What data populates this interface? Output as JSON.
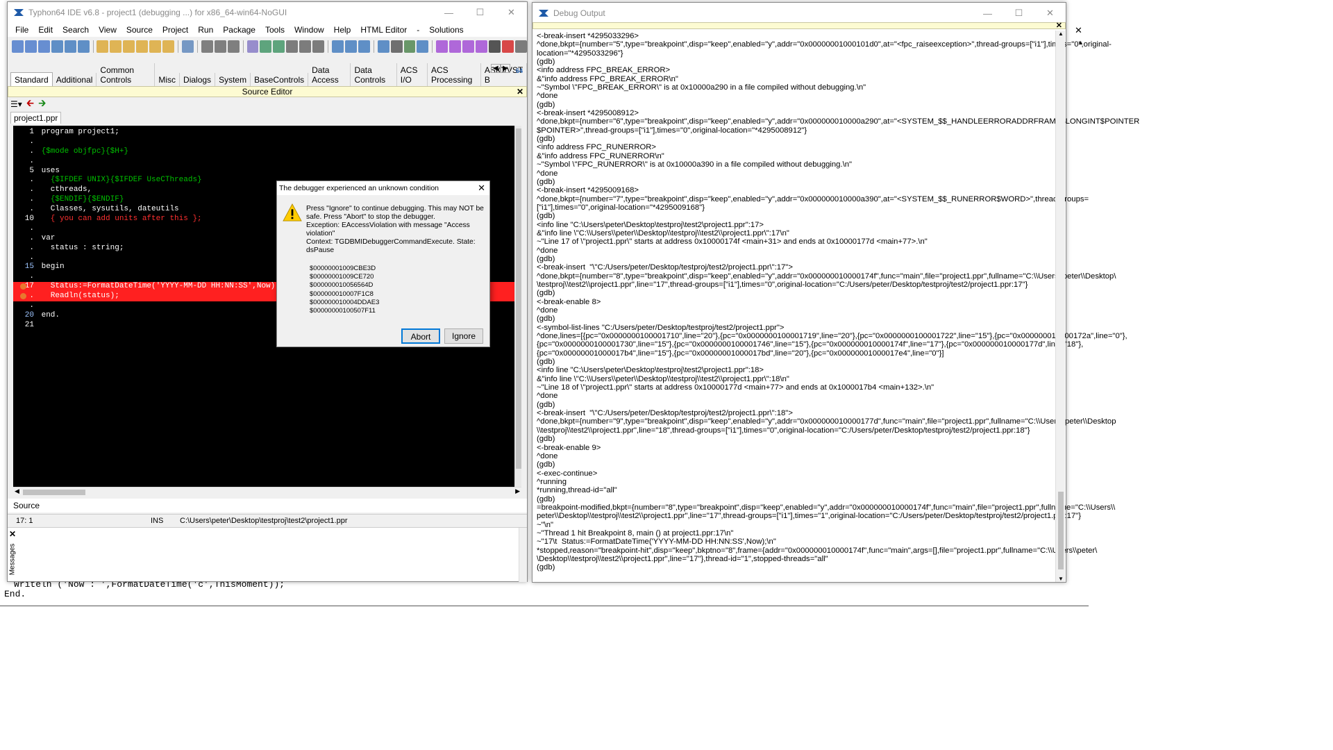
{
  "ide": {
    "title": "Typhon64 IDE v6.8 - project1 (debugging ...) for x86_64-win64-NoGUI",
    "menu": [
      "File",
      "Edit",
      "Search",
      "View",
      "Source",
      "Project",
      "Run",
      "Package",
      "Tools",
      "Window",
      "Help",
      "HTML Editor",
      "-",
      "Solutions"
    ],
    "palette_tabs": [
      "Standard",
      "Additional",
      "Common Controls",
      "Misc",
      "Dialogs",
      "System",
      "BaseControls",
      "Data Access",
      "Data Controls",
      "ACS I/O",
      "ACS Processing",
      "ASIO/VST B"
    ],
    "badge_64": "64",
    "source_editor_title": "Source Editor",
    "file_tab": "project1.ppr",
    "bottom_tab": "Source",
    "status": {
      "pos": "17:  1",
      "mode": "INS",
      "path": "C:\\Users\\peter\\Desktop\\testproj\\test2\\project1.ppr"
    },
    "messages_label": "Messages"
  },
  "code": [
    {
      "n": "1",
      "t": "program project1;"
    },
    {
      "n": ".",
      "t": ""
    },
    {
      "n": ".",
      "t": "{$mode objfpc}{$H+}"
    },
    {
      "n": ".",
      "t": ""
    },
    {
      "n": "5",
      "t": "uses"
    },
    {
      "n": ".",
      "t": "  {$IFDEF UNIX}{$IFDEF UseCThreads}"
    },
    {
      "n": ".",
      "t": "  cthreads,"
    },
    {
      "n": ".",
      "t": "  {$ENDIF}{$ENDIF}"
    },
    {
      "n": ".",
      "t": "  Classes, sysutils, dateutils"
    },
    {
      "n": "10",
      "t": "  { you can add units after this };"
    },
    {
      "n": ".",
      "t": ""
    },
    {
      "n": ".",
      "t": "var"
    },
    {
      "n": ".",
      "t": "  status : string;"
    },
    {
      "n": ".",
      "t": ""
    },
    {
      "n": "15",
      "t": "begin"
    },
    {
      "n": ".",
      "t": ""
    },
    {
      "n": "17",
      "t": "  Status:=FormatDateTime('YYYY-MM-DD HH:NN:SS',Now);"
    },
    {
      "n": ".",
      "t": "  Readln(status);"
    },
    {
      "n": ".",
      "t": ""
    },
    {
      "n": "20",
      "t": "end."
    },
    {
      "n": "21",
      "t": ""
    }
  ],
  "background_code": [
    "Writeln ('Now : ',FormatDateTime('c',ThisMoment));",
    "End."
  ],
  "dialog": {
    "title": "The debugger experienced an unknown condition",
    "message": "Press \"Ignore\" to continue debugging. This may NOT be\nsafe. Press \"Abort\" to stop the debugger.\nException: EAccessViolation with message \"Access\nviolation\"\nContext: TGDBMIDebuggerCommandExecute. State:\ndsPause",
    "addresses": [
      "$00000001009CBE3D",
      "$00000001009CE720",
      "$000000010056564D",
      "$000000010007F1C8",
      "$000000010004DDAE3",
      "$00000000100507F11"
    ],
    "abort_label": "Abort",
    "ignore_label": "Ignore"
  },
  "debug": {
    "title": "Debug Output",
    "lines": [
      "<-break-insert *4295033296>",
      "^done,bkpt={number=\"5\",type=\"breakpoint\",disp=\"keep\",enabled=\"y\",addr=\"0x00000001000101d0\",at=\"<fpc_raiseexception>\",thread-groups=[\"i1\"],times=\"0\",original-",
      "location=\"*4295033296\"}",
      "(gdb)",
      "<info address FPC_BREAK_ERROR>",
      "&\"info address FPC_BREAK_ERROR\\n\"",
      "~\"Symbol \\\"FPC_BREAK_ERROR\\\" is at 0x10000a290 in a file compiled without debugging.\\n\"",
      "^done",
      "(gdb)",
      "<-break-insert *4295008912>",
      "^done,bkpt={number=\"6\",type=\"breakpoint\",disp=\"keep\",enabled=\"y\",addr=\"0x000000010000a290\",at=\"<SYSTEM_$$_HANDLEERRORADDRFRAME$LONGINT$POINTER",
      "$POINTER>\",thread-groups=[\"i1\"],times=\"0\",original-location=\"*4295008912\"}",
      "(gdb)",
      "<info address FPC_RUNERROR>",
      "&\"info address FPC_RUNERROR\\n\"",
      "~\"Symbol \\\"FPC_RUNERROR\\\" is at 0x10000a390 in a file compiled without debugging.\\n\"",
      "^done",
      "(gdb)",
      "<-break-insert *4295009168>",
      "^done,bkpt={number=\"7\",type=\"breakpoint\",disp=\"keep\",enabled=\"y\",addr=\"0x000000010000a390\",at=\"<SYSTEM_$$_RUNERROR$WORD>\",thread-groups=",
      "[\"i1\"],times=\"0\",original-location=\"*4295009168\"}",
      "(gdb)",
      "<info line \"C:\\Users\\peter\\Desktop\\testproj\\test2\\project1.ppr\":17>",
      "&\"info line \\\"C:\\\\Users\\\\peter\\\\Desktop\\\\testproj\\\\test2\\\\project1.ppr\\\":17\\n\"",
      "~\"Line 17 of \\\"project1.ppr\\\" starts at address 0x10000174f <main+31> and ends at 0x10000177d <main+77>.\\n\"",
      "^done",
      "(gdb)",
      "<-break-insert  \"\\\"C:/Users/peter/Desktop/testproj/test2/project1.ppr\\\":17\">",
      "^done,bkpt={number=\"8\",type=\"breakpoint\",disp=\"keep\",enabled=\"y\",addr=\"0x000000010000174f\",func=\"main\",file=\"project1.ppr\",fullname=\"C:\\\\Users\\\\peter\\\\Desktop\\",
      "\\testproj\\\\test2\\\\project1.ppr\",line=\"17\",thread-groups=[\"i1\"],times=\"0\",original-location=\"C:/Users/peter/Desktop/testproj/test2/project1.ppr:17\"}",
      "(gdb)",
      "<-break-enable 8>",
      "^done",
      "(gdb)",
      "<-symbol-list-lines \"C:/Users/peter/Desktop/testproj/test2/project1.ppr\">",
      "^done,lines=[{pc=\"0x0000000100001710\",line=\"20\"},{pc=\"0x0000000100001719\",line=\"20\"},{pc=\"0x0000000100001722\",line=\"15\"},{pc=\"0x000000010000172a\",line=\"0\"},",
      "{pc=\"0x0000000100001730\",line=\"15\"},{pc=\"0x0000000100001746\",line=\"15\"},{pc=\"0x000000010000174f\",line=\"17\"},{pc=\"0x000000010000177d\",line=\"18\"},",
      "{pc=\"0x00000001000017b4\",line=\"15\"},{pc=\"0x00000001000017bd\",line=\"20\"},{pc=\"0x00000001000017e4\",line=\"0\"}]",
      "(gdb)",
      "<info line \"C:\\Users\\peter\\Desktop\\testproj\\test2\\project1.ppr\":18>",
      "&\"info line \\\"C:\\\\Users\\\\peter\\\\Desktop\\\\testproj\\\\test2\\\\project1.ppr\\\":18\\n\"",
      "~\"Line 18 of \\\"project1.ppr\\\" starts at address 0x10000177d <main+77> and ends at 0x1000017b4 <main+132>.\\n\"",
      "^done",
      "(gdb)",
      "<-break-insert  \"\\\"C:/Users/peter/Desktop/testproj/test2/project1.ppr\\\":18\">",
      "^done,bkpt={number=\"9\",type=\"breakpoint\",disp=\"keep\",enabled=\"y\",addr=\"0x000000010000177d\",func=\"main\",file=\"project1.ppr\",fullname=\"C:\\\\Users\\\\peter\\\\Desktop",
      "\\\\testproj\\\\test2\\\\project1.ppr\",line=\"18\",thread-groups=[\"i1\"],times=\"0\",original-location=\"C:/Users/peter/Desktop/testproj/test2/project1.ppr:18\"}",
      "(gdb)",
      "<-break-enable 9>",
      "^done",
      "(gdb)",
      "<-exec-continue>",
      "^running",
      "*running,thread-id=\"all\"",
      "(gdb)",
      "=breakpoint-modified,bkpt={number=\"8\",type=\"breakpoint\",disp=\"keep\",enabled=\"y\",addr=\"0x000000010000174f\",func=\"main\",file=\"project1.ppr\",fullname=\"C:\\\\Users\\\\",
      "peter\\\\Desktop\\\\testproj\\\\test2\\\\project1.ppr\",line=\"17\",thread-groups=[\"i1\"],times=\"1\",original-location=\"C:/Users/peter/Desktop/testproj/test2/project1.ppr:17\"}",
      "~\"\\n\"",
      "~\"Thread 1 hit Breakpoint 8, main () at project1.ppr:17\\n\"",
      "~\"17\\t  Status:=FormatDateTime('YYYY-MM-DD HH:NN:SS',Now);\\n\"",
      "*stopped,reason=\"breakpoint-hit\",disp=\"keep\",bkptno=\"8\",frame={addr=\"0x000000010000174f\",func=\"main\",args=[],file=\"project1.ppr\",fullname=\"C:\\\\Users\\\\peter\\",
      "\\Desktop\\\\testproj\\\\test2\\\\project1.ppr\",line=\"17\"},thread-id=\"1\",stopped-threads=\"all\"",
      "(gdb)"
    ]
  },
  "colors": {
    "accent": "#0078d7",
    "breakpoint_line": "#ff2020",
    "editor_bg": "#000000",
    "panel_header": "#fdfbd2"
  }
}
